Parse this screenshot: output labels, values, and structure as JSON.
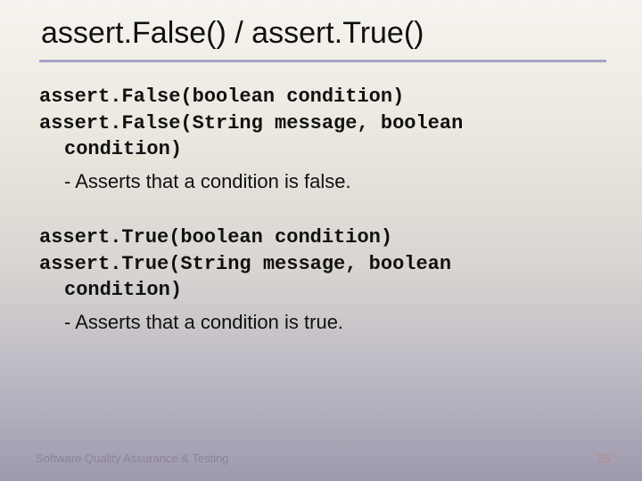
{
  "title": "assert.False() / assert.True()",
  "sections": [
    {
      "sig1": "assert.False(boolean condition)",
      "sig2a": "assert.False(String message, boolean",
      "sig2b": "condition)",
      "desc": "- Asserts that a condition is false."
    },
    {
      "sig1": "assert.True(boolean condition)",
      "sig2a": "assert.True(String message, boolean",
      "sig2b": "condition)",
      "desc": "- Asserts that a condition is true."
    }
  ],
  "footer": "Software Quality Assurance & Testing",
  "page": "25"
}
